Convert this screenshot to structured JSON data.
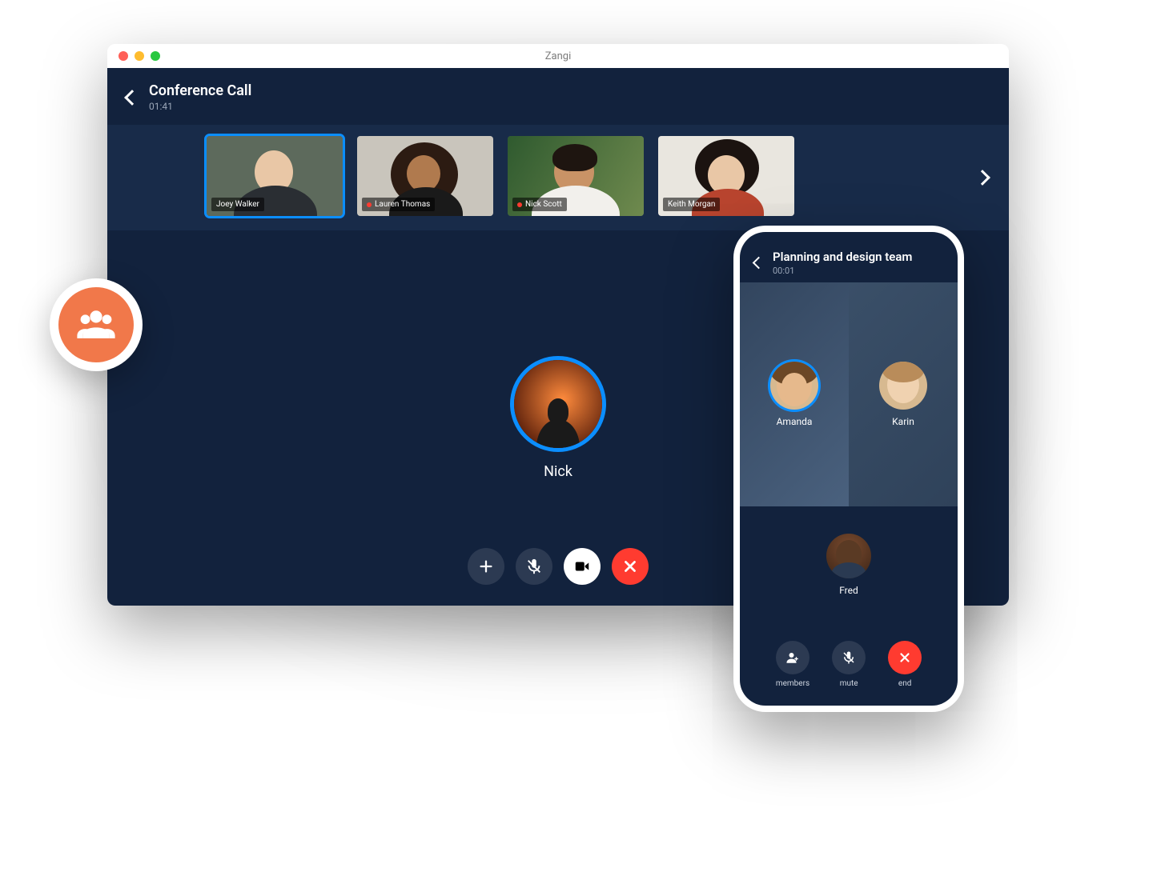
{
  "window": {
    "app_name": "Zangi",
    "header": {
      "title": "Conference Call",
      "duration": "01:41"
    },
    "participants": [
      {
        "name": "Joey Walker",
        "selected": true,
        "muted": false
      },
      {
        "name": "Lauren Thomas",
        "selected": false,
        "muted": true
      },
      {
        "name": "Nick Scott",
        "selected": false,
        "muted": true
      },
      {
        "name": "Keith Morgan",
        "selected": false,
        "muted": false
      }
    ],
    "active_speaker": "Nick",
    "controls": {
      "add_icon": "plus-icon",
      "mute_icon": "mic-off-icon",
      "video_icon": "video-icon",
      "end_icon": "close-icon"
    }
  },
  "phone": {
    "header": {
      "title": "Planning and design team",
      "duration": "00:01"
    },
    "grid": [
      {
        "name": "Amanda",
        "ring": true
      },
      {
        "name": "Karin",
        "ring": false
      }
    ],
    "lower_participant": "Fred",
    "controls": [
      {
        "key": "members",
        "label": "members",
        "icon": "add-member-icon",
        "style": "dark"
      },
      {
        "key": "mute",
        "label": "mute",
        "icon": "mic-off-icon",
        "style": "dark"
      },
      {
        "key": "end",
        "label": "end",
        "icon": "close-icon",
        "style": "red"
      }
    ]
  },
  "badge": {
    "icon": "group-icon",
    "color": "#f1784a"
  }
}
